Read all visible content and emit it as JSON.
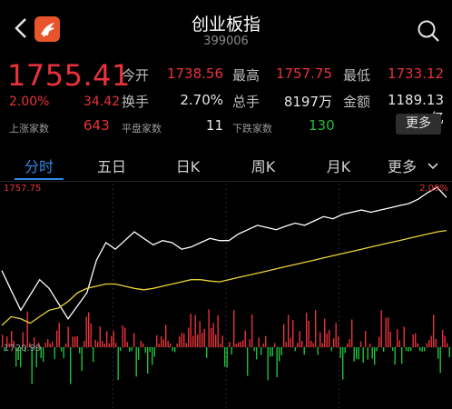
{
  "header": {
    "title": "创业板指",
    "code": "399006"
  },
  "quote": {
    "price": "1755.41",
    "change_pct": "2.00%",
    "change": "34.42",
    "up_count_label": "上涨家数",
    "up_count": "643",
    "flat_count_label": "平盘家数",
    "flat_count": "11",
    "down_count_label": "下跌家数",
    "down_count": "130",
    "more_label": "更多"
  },
  "stats": [
    {
      "label": "今开",
      "value": "1738.56"
    },
    {
      "label": "最高",
      "value": "1757.75"
    },
    {
      "label": "最低",
      "value": "1733.12"
    },
    {
      "label": "换手",
      "value": "2.70%"
    },
    {
      "label": "总手",
      "value": "8197万"
    },
    {
      "label": "金额",
      "value": "1189.13亿"
    }
  ],
  "tabs": [
    "分时",
    "五日",
    "日K",
    "周K",
    "月K",
    "更多"
  ],
  "chart_labels": {
    "y_top": "1757.75",
    "y_top_right": "2.09%",
    "y_bottom": "1720.99"
  },
  "colors": {
    "up": "#e9323a",
    "down": "#1fbf3a",
    "accent": "#2e8ae6",
    "price_line": "#ffffff",
    "avg_line": "#e8d23a"
  },
  "chart_data": {
    "type": "line",
    "ylim": [
      1720.99,
      1757.75
    ],
    "series": [
      {
        "values": [
          1738.6,
          1734.0,
          1729.5,
          1733.0,
          1736.5,
          1734.5,
          1731.0,
          1727.5,
          1730.5,
          1733.5,
          1741.0,
          1745.0,
          1743.5,
          1745.5,
          1747.5,
          1746.0,
          1744.5,
          1745.5,
          1745.0,
          1743.5,
          1744.0,
          1745.0,
          1746.0,
          1745.5,
          1745.5,
          1747.0,
          1748.0,
          1749.0,
          1748.5,
          1748.0,
          1748.8,
          1749.5,
          1749.0,
          1750.0,
          1751.0,
          1750.5,
          1751.5,
          1752.0,
          1752.5,
          1752.0,
          1752.5,
          1753.0,
          1753.5,
          1754.0,
          1755.0,
          1756.5,
          1757.75,
          1755.4
        ]
      },
      {
        "values": [
          1726.0,
          1728.0,
          1727.5,
          1726.5,
          1728.0,
          1729.5,
          1730.0,
          1731.5,
          1733.5,
          1734.5,
          1735.0,
          1735.5,
          1735.5,
          1735.0,
          1734.5,
          1734.2,
          1734.5,
          1735.0,
          1735.5,
          1736.0,
          1736.5,
          1736.5,
          1736.2,
          1736.0,
          1736.5,
          1737.0,
          1737.5,
          1738.0,
          1738.5,
          1739.0,
          1739.5,
          1740.0,
          1740.5,
          1741.0,
          1741.5,
          1742.0,
          1742.5,
          1743.0,
          1743.5,
          1744.0,
          1744.5,
          1745.0,
          1745.5,
          1746.0,
          1746.5,
          1747.0,
          1747.5,
          1747.8
        ]
      }
    ]
  }
}
